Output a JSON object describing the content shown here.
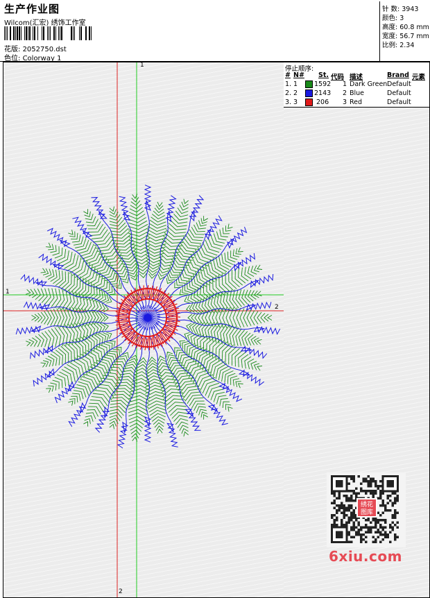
{
  "header": {
    "title": "生产作业图",
    "studio": "Wilcom(汇宏) 绣饰工作室",
    "design_label": "花版:",
    "design_value": "2052750.dst",
    "colorway_label": "色位:",
    "colorway_value": "Colorway 1"
  },
  "stats": {
    "stitches_label": "针 数:",
    "stitches_value": "3943",
    "colors_label": "颜色:",
    "colors_value": "3",
    "height_label": "高度:",
    "height_value": "60.8 mm",
    "width_label": "宽度:",
    "width_value": "56.7 mm",
    "scale_label": "比例:",
    "scale_value": "2.34"
  },
  "stop_sequence": {
    "title": "停止顺序:",
    "headers": {
      "hash": "#",
      "n": "N#",
      "st": "St.",
      "code": "代码",
      "desc": "描述",
      "brand": "Brand",
      "element": "元素"
    },
    "rows": [
      {
        "idx": "1.",
        "n": "1",
        "color": "#1a8a1a",
        "st": "1592",
        "code": "1",
        "desc": "Dark Green",
        "brand": "Default"
      },
      {
        "idx": "2.",
        "n": "2",
        "color": "#1a1ae0",
        "st": "2143",
        "code": "2",
        "desc": "Blue",
        "brand": "Default"
      },
      {
        "idx": "3.",
        "n": "3",
        "color": "#e01a1a",
        "st": "206",
        "code": "3",
        "desc": "Red",
        "brand": "Default"
      }
    ]
  },
  "axes": {
    "top_label": "1",
    "left_label": "1",
    "right_label": "2",
    "bottom_label": "2"
  },
  "watermark": {
    "text": "6xiu.com",
    "qr_caption": "绣花图库"
  },
  "colors": {
    "green": "#1a8a1a",
    "blue": "#1a1ae0",
    "red": "#e01a1a",
    "axis_green": "#22cc22",
    "axis_red": "#dd2222"
  }
}
